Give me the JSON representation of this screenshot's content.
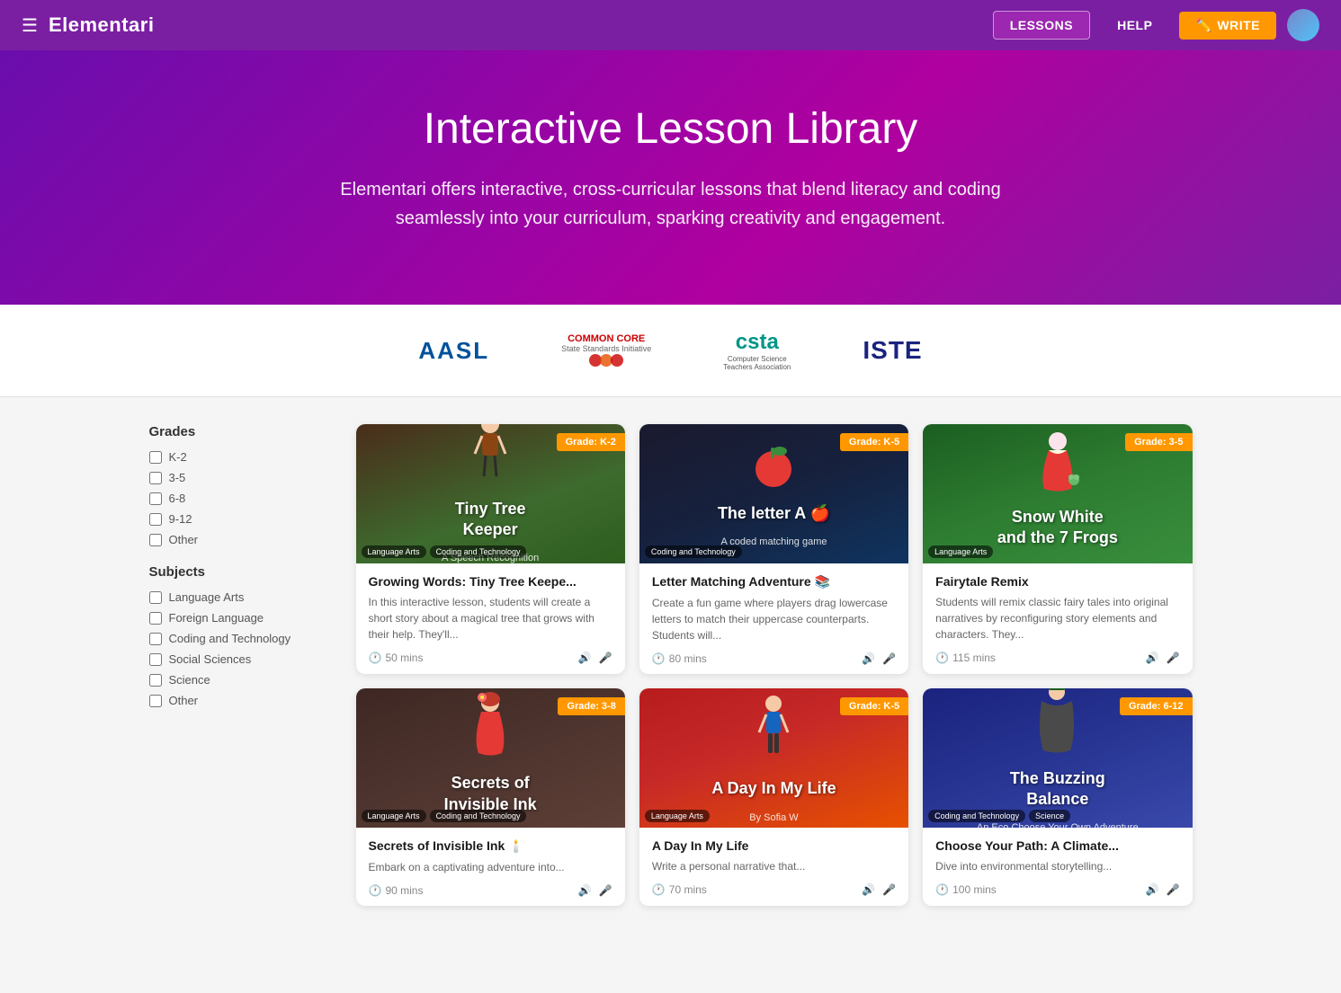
{
  "navbar": {
    "hamburger_label": "☰",
    "brand": "Elementari",
    "lessons_label": "LESSONS",
    "help_label": "HELP",
    "write_label": "WRITE"
  },
  "hero": {
    "title": "Interactive Lesson Library",
    "subtitle": "Elementari offers interactive, cross-curricular lessons that blend literacy and coding seamlessly into your curriculum, sparking creativity and engagement."
  },
  "logos": [
    {
      "id": "aasl",
      "label": "AASL"
    },
    {
      "id": "common-core",
      "label": "COMMON CORE"
    },
    {
      "id": "csta",
      "label": "csta"
    },
    {
      "id": "iste",
      "label": "ISTE"
    }
  ],
  "sidebar": {
    "grades_title": "Grades",
    "grades": [
      {
        "id": "k-2",
        "label": "K-2"
      },
      {
        "id": "3-5",
        "label": "3-5"
      },
      {
        "id": "6-8",
        "label": "6-8"
      },
      {
        "id": "9-12",
        "label": "9-12"
      },
      {
        "id": "other-grade",
        "label": "Other"
      }
    ],
    "subjects_title": "Subjects",
    "subjects": [
      {
        "id": "language-arts",
        "label": "Language Arts"
      },
      {
        "id": "foreign-language",
        "label": "Foreign Language"
      },
      {
        "id": "coding-technology",
        "label": "Coding and Technology"
      },
      {
        "id": "social-sciences",
        "label": "Social Sciences"
      },
      {
        "id": "science",
        "label": "Science"
      },
      {
        "id": "other-subject",
        "label": "Other"
      }
    ]
  },
  "lessons": [
    {
      "id": "tiny-tree-keeper",
      "grade": "Grade: K-2",
      "title": "Growing Words: Tiny Tree Keepe...",
      "description": "In this interactive lesson, students will create a short story about a magical tree that grows with their help. They'll...",
      "time": "50 mins",
      "tags": [
        "Language Arts",
        "Coding and Technology"
      ],
      "bg_theme": "tiny-tree",
      "card_title": "Tiny Tree Keeper",
      "card_subtitle": "A Speech Recognition Interactive Story"
    },
    {
      "id": "letter-matching",
      "grade": "Grade: K-5",
      "title": "Letter Matching Adventure 📚",
      "description": "Create a fun game where players drag lowercase letters to match their uppercase counterparts. Students will...",
      "time": "80 mins",
      "tags": [
        "Coding and Technology"
      ],
      "bg_theme": "letter-a",
      "card_title": "The letter A 🍎",
      "card_subtitle": "A coded matching game"
    },
    {
      "id": "fairytale-remix",
      "grade": "Grade: 3-5",
      "title": "Fairytale Remix",
      "description": "Students will remix classic fairy tales into original narratives by reconfiguring story elements and characters. They...",
      "time": "115 mins",
      "tags": [
        "Language Arts"
      ],
      "bg_theme": "snow-white",
      "card_title": "Snow White and the 7 Frogs",
      "card_subtitle": ""
    },
    {
      "id": "invisible-ink",
      "grade": "Grade: 3-8",
      "title": "Secrets of Invisible Ink 🕯️",
      "description": "Embark on a captivating adventure into...",
      "time": "90 mins",
      "tags": [
        "Language Arts",
        "Coding and Technology"
      ],
      "bg_theme": "invisible-ink",
      "card_title": "Secrets of Invisible Ink",
      "card_subtitle": ""
    },
    {
      "id": "day-in-my-life",
      "grade": "Grade: K-5",
      "title": "A Day In My Life",
      "description": "Write a personal narrative that...",
      "time": "70 mins",
      "tags": [
        "Language Arts"
      ],
      "bg_theme": "day-my-life",
      "card_title": "A Day In My Life",
      "card_subtitle": "By Sofia W"
    },
    {
      "id": "buzzing-balance",
      "grade": "Grade: 6-12",
      "title": "Choose Your Path: A Climate...",
      "description": "Dive into environmental storytelling...",
      "time": "100 mins",
      "tags": [
        "Coding and Technology",
        "Science"
      ],
      "bg_theme": "buzzing-balance",
      "card_title": "The Buzzing Balance",
      "card_subtitle": "An Eco Choose Your Own Adventure"
    }
  ]
}
